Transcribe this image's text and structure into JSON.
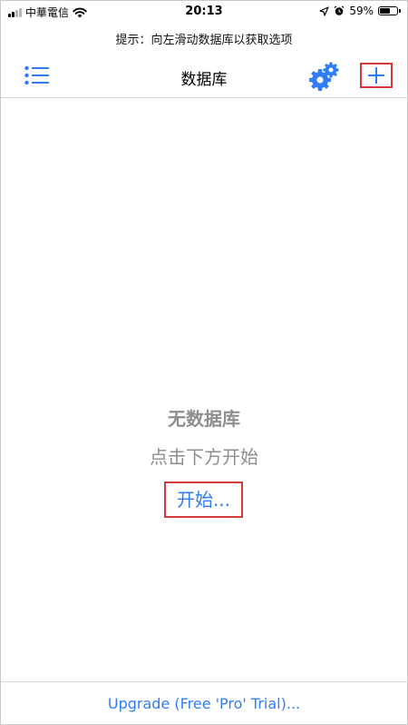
{
  "status_bar": {
    "carrier": "中華電信",
    "time": "20:13",
    "battery_percent_text": "59%",
    "battery_level": 0.59,
    "icons": [
      "signal-icon",
      "wifi-icon",
      "location-arrow-icon",
      "alarm-clock-icon",
      "battery-icon"
    ]
  },
  "hint": {
    "text": "提示：向左滑动数据库以获取选项"
  },
  "nav": {
    "title": "数据库",
    "left_icon": "list-icon",
    "right_icons": [
      "gear-icon",
      "plus-icon"
    ]
  },
  "empty_state": {
    "title": "无数据库",
    "subtitle": "点击下方开始",
    "start_link": "开始..."
  },
  "footer": {
    "upgrade_link": "Upgrade (Free 'Pro' Trial)..."
  },
  "colors": {
    "accent": "#2f7cf6",
    "highlight_box": "#d43a3a",
    "muted_text": "#8e8e8e",
    "divider": "#d6d6d6"
  }
}
